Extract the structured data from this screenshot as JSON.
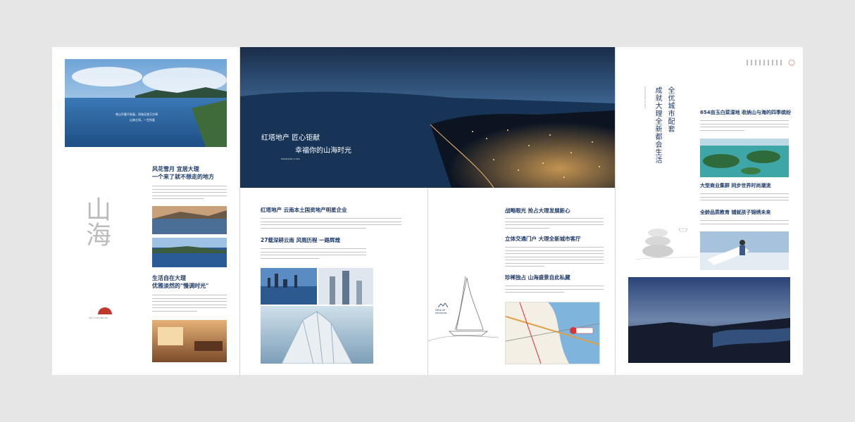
{
  "panel1": {
    "hero_caption_line1": "苍山不墨千秋画，洱海无弦万古琴",
    "hero_caption_line2": "山海之间，一生所爱",
    "heading1_line1": "风花雪月 宜居大理",
    "heading1_line2": "一个来了就不想走的地方",
    "heading2_line1": "生活自在大理",
    "heading2_line2": "优雅淡然的\"慢调时光\"",
    "calligraphy": "山海",
    "seal_text": "SEA of MOUNTAIN"
  },
  "panel2": {
    "hero_line1": "红塔地产 匠心钜献",
    "hero_line2": "幸福你的山海时光",
    "hero_logo": "MOUNTAIN of SEA",
    "heading1": "红塔地产 云南本土国资地产明星企业",
    "heading2": "27载深耕云南 风雨历程 一路辉煌"
  },
  "panel3": {
    "heading1": "战略眼光 抢占大理发展新心",
    "heading2": "立体交通门户 大理全新城市客厅",
    "heading3": "珍稀独占 山海盛景自此私藏",
    "logo_line1": "SEA of",
    "logo_line2": "MOUNTAIN"
  },
  "panel4": {
    "vertical_title1": "全优城市配套",
    "vertical_title2": "成就大理全新都会生活",
    "vertical_small": "MOUNTAIN OF SEA",
    "heading1": "654亩玉白菜湿地 收纳山与海的四季缤纷",
    "heading2": "大型商业集群 同步世界时尚潮流",
    "heading3": "全龄品质教育 铺就孩子锦绣未来"
  },
  "colors": {
    "heading": "#1e3a6b",
    "background": "#e6e6e6",
    "panel": "#ffffff",
    "seal": "#c0392b"
  }
}
